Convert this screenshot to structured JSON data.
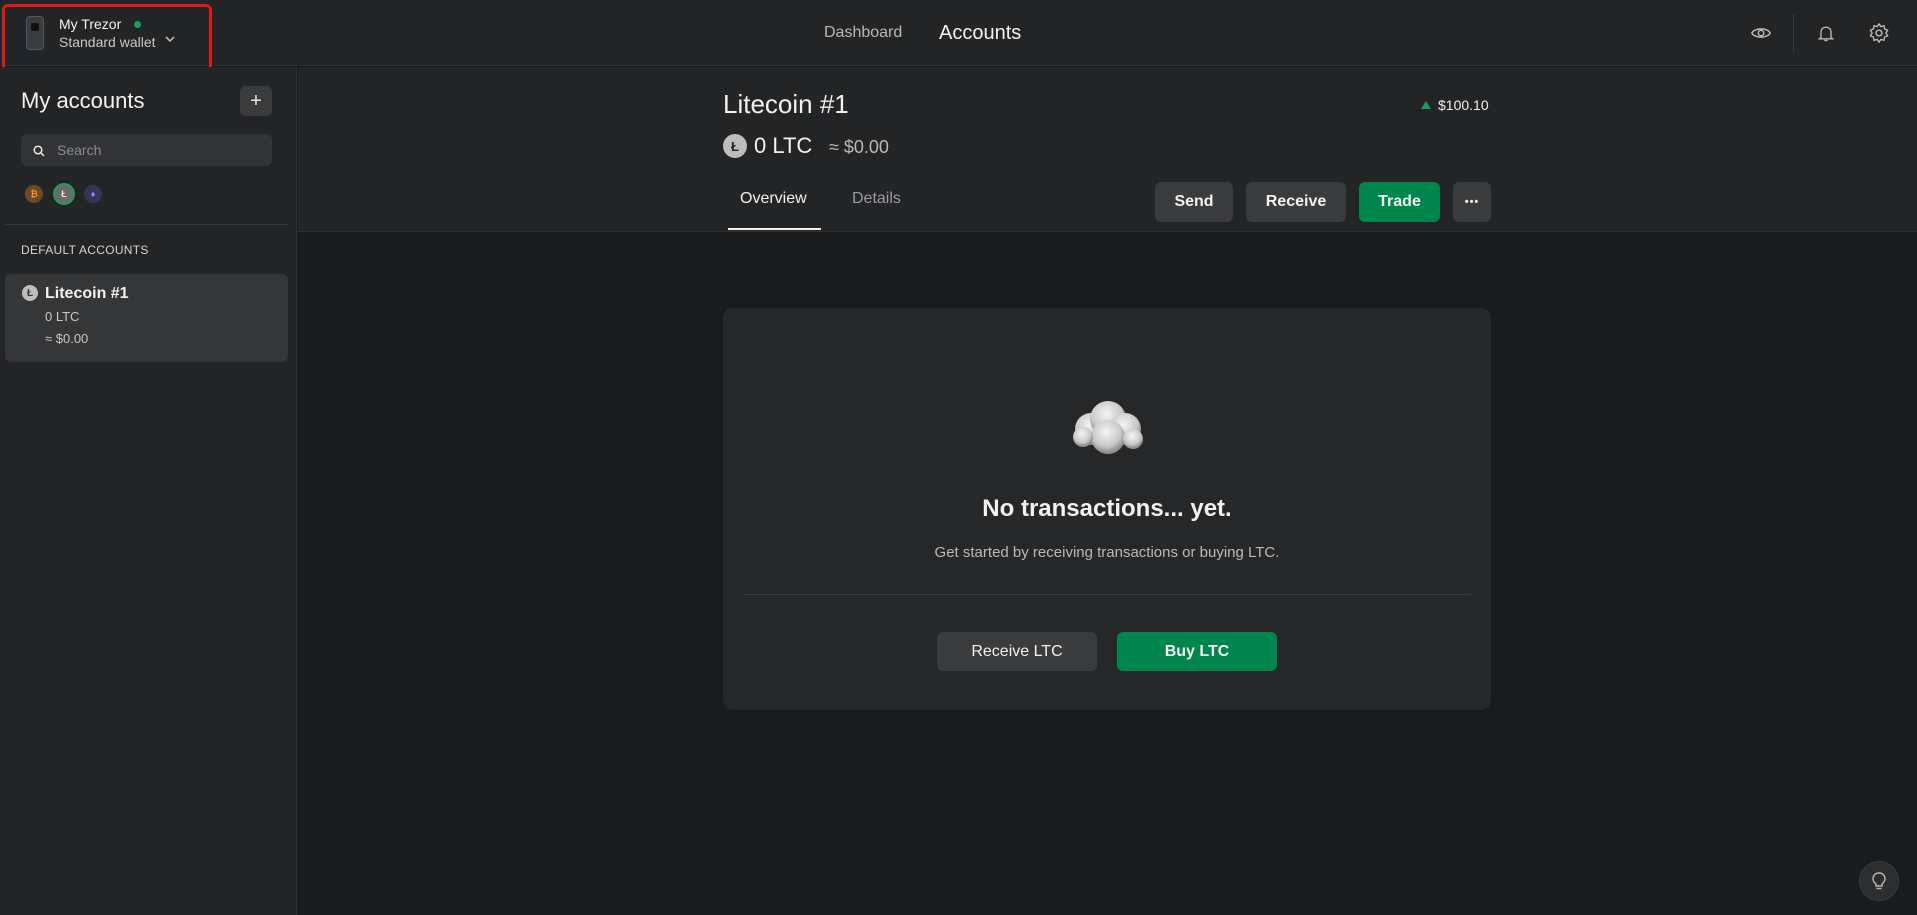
{
  "header": {
    "device_name": "My Trezor",
    "wallet_type": "Standard wallet",
    "nav": {
      "dashboard": "Dashboard",
      "accounts": "Accounts"
    }
  },
  "sidebar": {
    "title": "My accounts",
    "add_label": "+",
    "search_placeholder": "Search",
    "coin_filters": [
      {
        "symbol": "₿",
        "color": "#f7931a"
      },
      {
        "symbol": "Ł",
        "color": "#bdbdbd"
      },
      {
        "symbol": "♦",
        "color": "#8c8cf0"
      }
    ],
    "section_label": "DEFAULT ACCOUNTS",
    "accounts": [
      {
        "name": "Litecoin #1",
        "balance": "0 LTC",
        "fiat": "≈ $0.00",
        "symbol": "Ł"
      }
    ]
  },
  "account": {
    "title": "Litecoin #1",
    "price": "$100.10",
    "coin_symbol": "Ł",
    "balance": "0 LTC",
    "fiat": "≈ $0.00",
    "tabs": [
      "Overview",
      "Details"
    ],
    "actions": {
      "send": "Send",
      "receive": "Receive",
      "trade": "Trade",
      "more": "•••"
    }
  },
  "empty_state": {
    "title": "No transactions... yet.",
    "subtitle": "Get started by receiving transactions or buying LTC.",
    "receive_label": "Receive LTC",
    "buy_label": "Buy LTC"
  },
  "colors": {
    "accent_green": "#00854d",
    "background": "#1a1b1d",
    "panel": "#232425",
    "highlight_red": "#e3161c"
  }
}
